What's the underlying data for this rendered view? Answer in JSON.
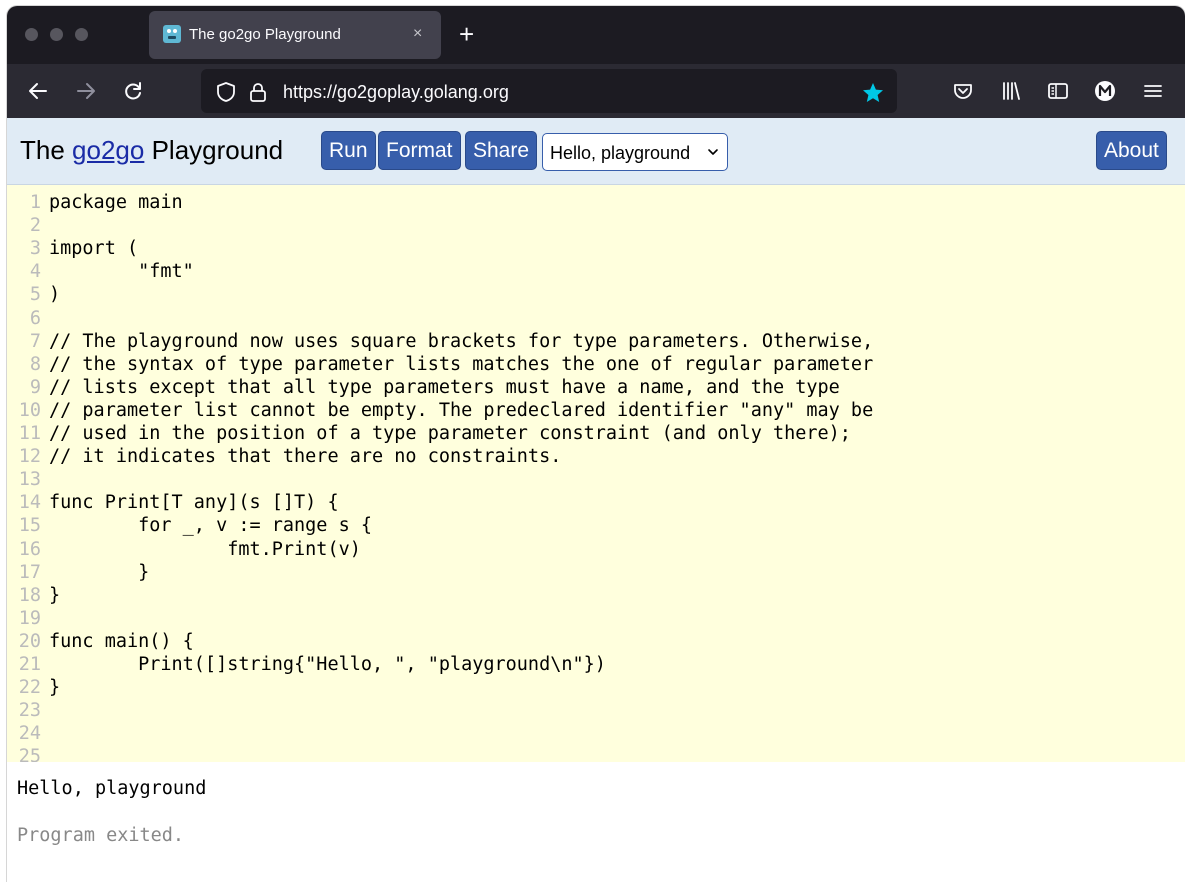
{
  "browser": {
    "tab": {
      "title": "The go2go Playground",
      "close": "×"
    },
    "new_tab": "+",
    "url": "https://go2goplay.golang.org",
    "colors": {
      "star": "#00c8e6",
      "chrome_dark": "#1c1b22",
      "navbar": "#2b2a33"
    }
  },
  "header": {
    "title_prefix": "The",
    "title_link": "go2go",
    "title_suffix": "Playground",
    "run_label": "Run",
    "format_label": "Format",
    "share_label": "Share",
    "example_select": "Hello, playground",
    "about_label": "About",
    "colors": {
      "button": "#375eab",
      "header_bg": "#e0ebf5"
    }
  },
  "editor": {
    "background": "#ffffdd",
    "lines": [
      {
        "n": "1",
        "t": "package main"
      },
      {
        "n": "2",
        "t": ""
      },
      {
        "n": "3",
        "t": "import ("
      },
      {
        "n": "4",
        "t": "        \"fmt\""
      },
      {
        "n": "5",
        "t": ")"
      },
      {
        "n": "6",
        "t": ""
      },
      {
        "n": "7",
        "t": "// The playground now uses square brackets for type parameters. Otherwise,"
      },
      {
        "n": "8",
        "t": "// the syntax of type parameter lists matches the one of regular parameter"
      },
      {
        "n": "9",
        "t": "// lists except that all type parameters must have a name, and the type"
      },
      {
        "n": "10",
        "t": "// parameter list cannot be empty. The predeclared identifier \"any\" may be"
      },
      {
        "n": "11",
        "t": "// used in the position of a type parameter constraint (and only there);"
      },
      {
        "n": "12",
        "t": "// it indicates that there are no constraints."
      },
      {
        "n": "13",
        "t": ""
      },
      {
        "n": "14",
        "t": "func Print[T any](s []T) {"
      },
      {
        "n": "15",
        "t": "        for _, v := range s {"
      },
      {
        "n": "16",
        "t": "                fmt.Print(v)"
      },
      {
        "n": "17",
        "t": "        }"
      },
      {
        "n": "18",
        "t": "}"
      },
      {
        "n": "19",
        "t": ""
      },
      {
        "n": "20",
        "t": "func main() {"
      },
      {
        "n": "21",
        "t": "        Print([]string{\"Hello, \", \"playground\\n\"})"
      },
      {
        "n": "22",
        "t": "}"
      },
      {
        "n": "23",
        "t": ""
      },
      {
        "n": "24",
        "t": ""
      },
      {
        "n": "25",
        "t": ""
      }
    ]
  },
  "output": {
    "stdout": "Hello, playground",
    "status": "Program exited."
  }
}
